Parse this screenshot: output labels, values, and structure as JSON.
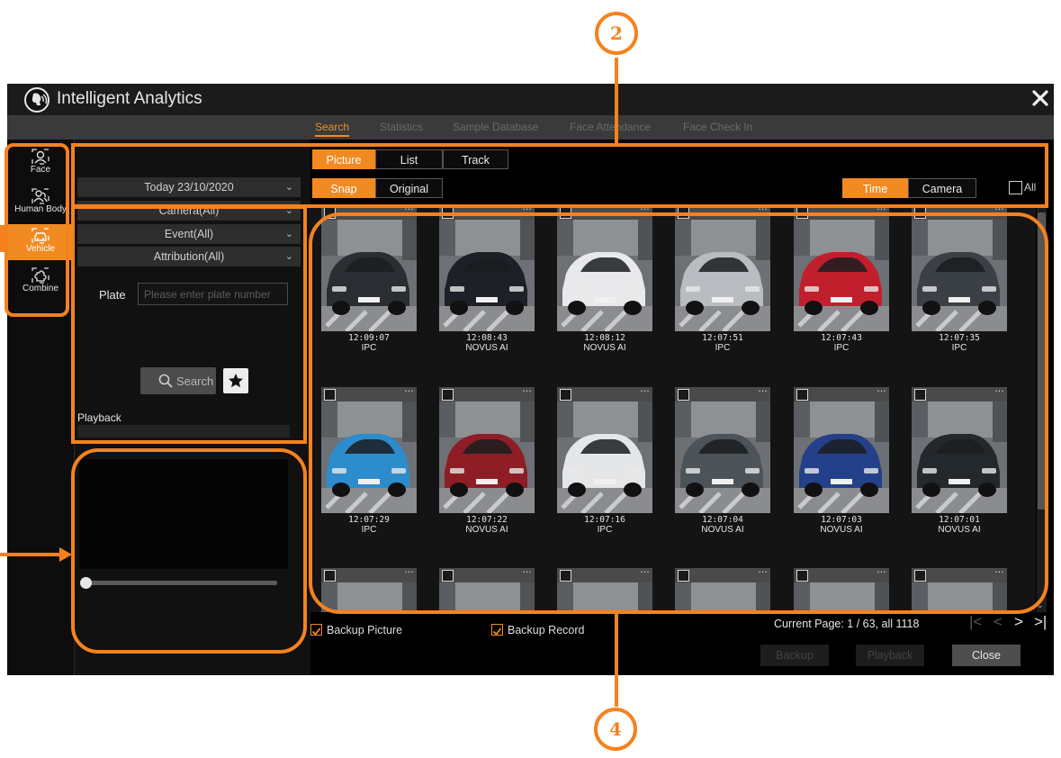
{
  "app": {
    "title": "Intelligent Analytics"
  },
  "tabs": [
    {
      "label": "Search",
      "active": true
    },
    {
      "label": "Statistics",
      "active": false
    },
    {
      "label": "Sample Database",
      "active": false
    },
    {
      "label": "Face Attendance",
      "active": false
    },
    {
      "label": "Face Check In",
      "active": false
    }
  ],
  "sidebar": {
    "items": [
      {
        "label": "Face",
        "icon": "face-icon",
        "active": false
      },
      {
        "label": "Human Body",
        "icon": "human-body-icon",
        "active": false
      },
      {
        "label": "Vehicle",
        "icon": "vehicle-icon",
        "active": true
      },
      {
        "label": "Combine",
        "icon": "combine-icon",
        "active": false
      }
    ]
  },
  "filters": {
    "date": "Today 23/10/2020",
    "camera": "Camera(All)",
    "event": "Event(All)",
    "attribution": "Attribution(All)",
    "plate_label": "Plate",
    "plate_placeholder": "Please enter plate number",
    "plate_value": ""
  },
  "search_button": "Search",
  "playback_label": "Playback",
  "view_toggle": [
    "Picture",
    "List",
    "Track"
  ],
  "view_active": "Picture",
  "image_toggle": [
    "Snap",
    "Original"
  ],
  "image_active": "Snap",
  "sort_toggle": [
    "Time",
    "Camera"
  ],
  "sort_active": "Time",
  "select_all_label": "All",
  "results": [
    {
      "time": "12:09:07",
      "camera": "IPC",
      "car": "#2a2e33"
    },
    {
      "time": "12:08:43",
      "camera": "NOVUS AI",
      "car": "#1d2026"
    },
    {
      "time": "12:08:12",
      "camera": "NOVUS AI",
      "car": "#e9e9ec"
    },
    {
      "time": "12:07:51",
      "camera": "IPC",
      "car": "#b9bcc0"
    },
    {
      "time": "12:07:43",
      "camera": "IPC",
      "car": "#c21f2c"
    },
    {
      "time": "12:07:35",
      "camera": "IPC",
      "car": "#3a4045"
    },
    {
      "time": "12:07:29",
      "camera": "IPC",
      "car": "#2d8ccc"
    },
    {
      "time": "12:07:22",
      "camera": "NOVUS AI",
      "car": "#8e1d25"
    },
    {
      "time": "12:07:16",
      "camera": "IPC",
      "car": "#e4e6e8"
    },
    {
      "time": "12:07:04",
      "camera": "NOVUS AI",
      "car": "#4d5459"
    },
    {
      "time": "12:07:03",
      "camera": "NOVUS AI",
      "car": "#25408a"
    },
    {
      "time": "12:07:01",
      "camera": "NOVUS AI",
      "car": "#23282c"
    },
    {
      "time": "",
      "camera": "",
      "car": "#c7c9cc"
    },
    {
      "time": "",
      "camera": "",
      "car": "#d7d9db"
    },
    {
      "time": "",
      "camera": "",
      "car": "#8a8e91"
    },
    {
      "time": "",
      "camera": "",
      "car": "#a6aaad"
    },
    {
      "time": "",
      "camera": "",
      "car": "#5f6468"
    },
    {
      "time": "",
      "camera": "",
      "car": "#343a3f"
    }
  ],
  "footer": {
    "backup_picture": "Backup Picture",
    "backup_record": "Backup Record",
    "page_info": "Current Page: 1 / 63, all 1118",
    "backup": "Backup",
    "playback": "Playback",
    "close": "Close"
  },
  "callouts": {
    "top": "2",
    "bottom": "4"
  },
  "colors": {
    "accent": "#f28a22",
    "highlight": "#f5821f"
  }
}
